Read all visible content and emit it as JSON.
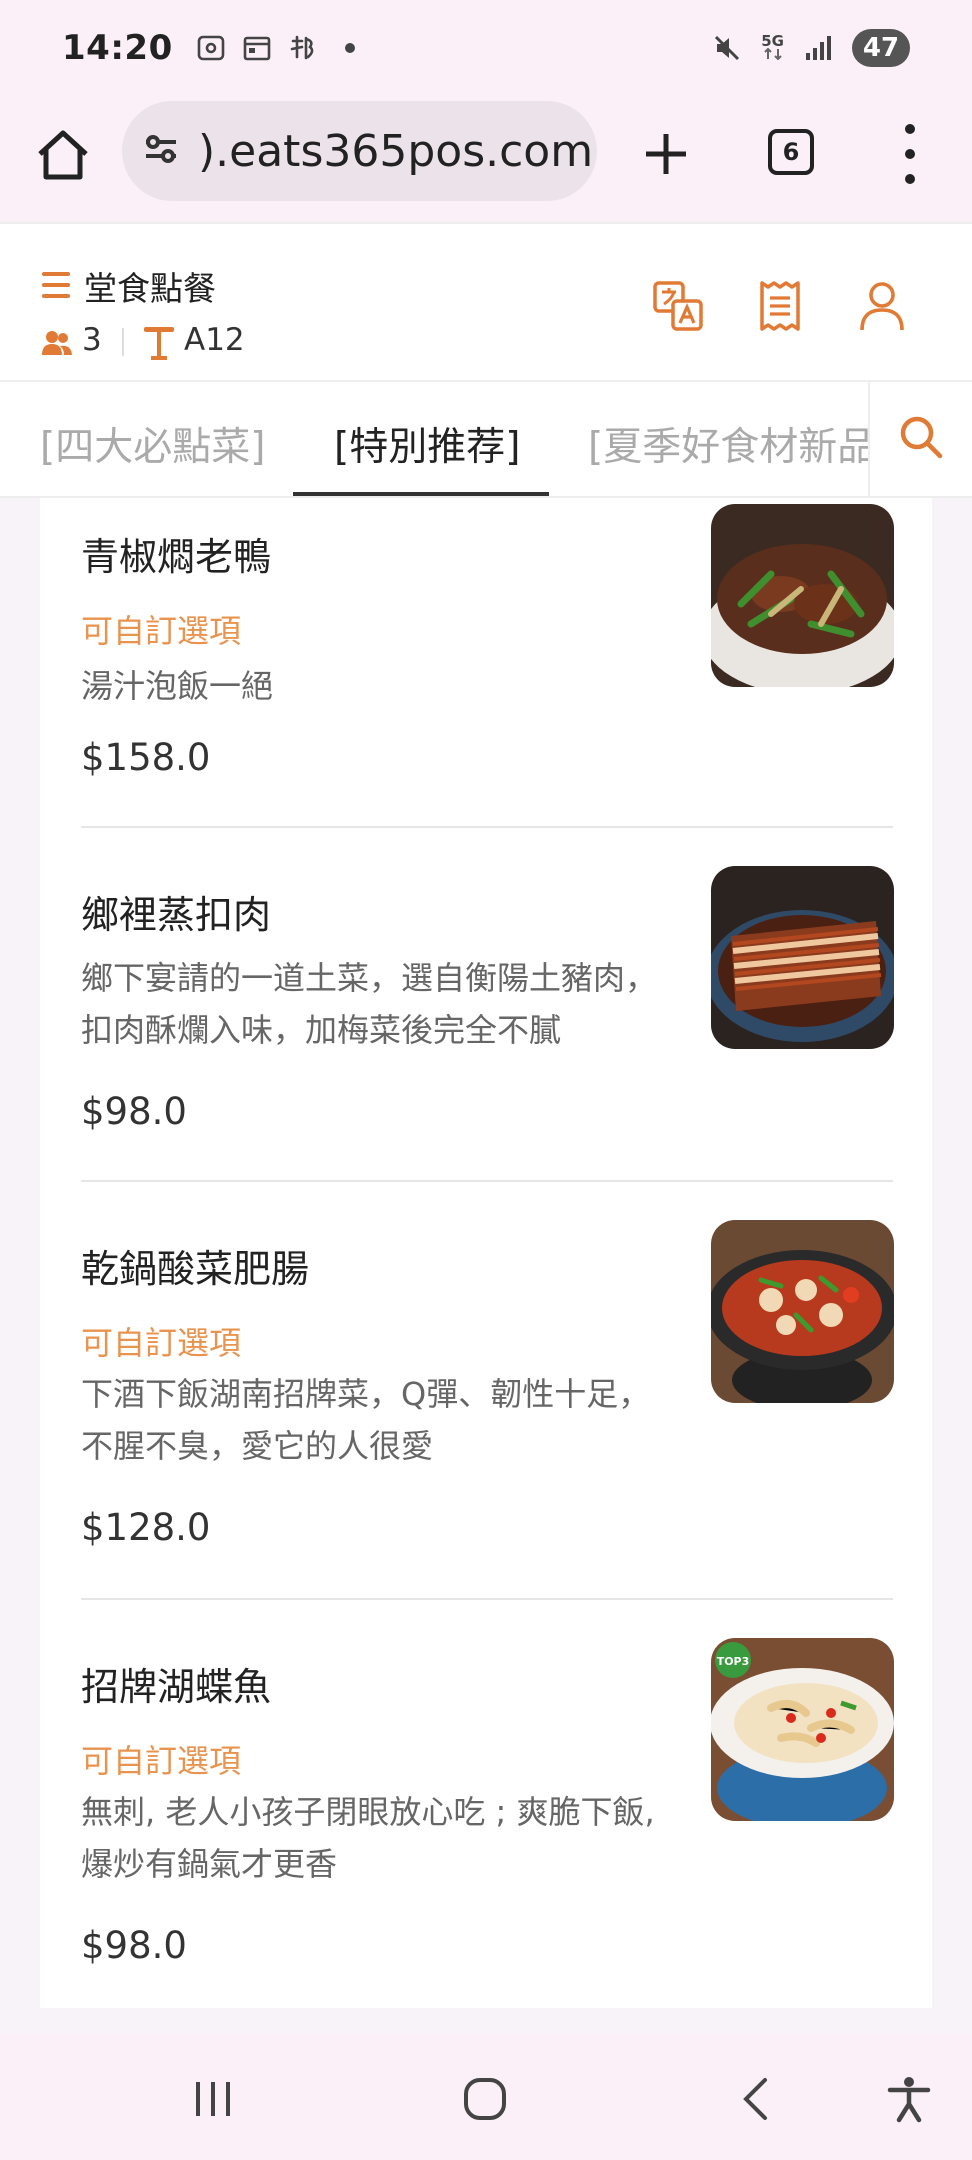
{
  "status_bar": {
    "time": "14:20",
    "network": "5G",
    "battery": "47"
  },
  "browser": {
    "url": ").eats365pos.com",
    "tab_count": "6"
  },
  "header": {
    "title": "堂食點餐",
    "guests": "3",
    "table": "A12"
  },
  "tabs": [
    {
      "label": "[四大必點菜]",
      "active": false
    },
    {
      "label": "[特別推荐]",
      "active": true
    },
    {
      "label": "[夏季好食材新品",
      "active": false
    }
  ],
  "items": [
    {
      "name": "青椒燜老鴨",
      "option": "可自訂選項",
      "desc": [
        "湯汁泡飯一絕"
      ],
      "price": "$158.0"
    },
    {
      "name": "鄉裡蒸扣肉",
      "option": "",
      "desc": [
        "鄉下宴請的一道土菜，選自衡陽土豬肉，",
        "扣肉酥爛入味，加梅菜後完全不膩"
      ],
      "price": "$98.0"
    },
    {
      "name": "乾鍋酸菜肥腸",
      "option": "可自訂選項",
      "desc": [
        "下酒下飯湖南招牌菜，Q彈、韌性十足，",
        "不腥不臭，愛它的人很愛"
      ],
      "price": "$128.0"
    },
    {
      "name": "招牌湖蝶魚",
      "option": "可自訂選項",
      "desc": [
        "無刺, 老人小孩子閉眼放心吃 ; 爽脆下飯,",
        "爆炒有鍋氣才更香"
      ],
      "price": "$98.0"
    }
  ],
  "photo_badge": "TOP3",
  "colors": {
    "accent": "#e07a34",
    "option": "#e8944f",
    "chrome": "#fbf0f8"
  }
}
